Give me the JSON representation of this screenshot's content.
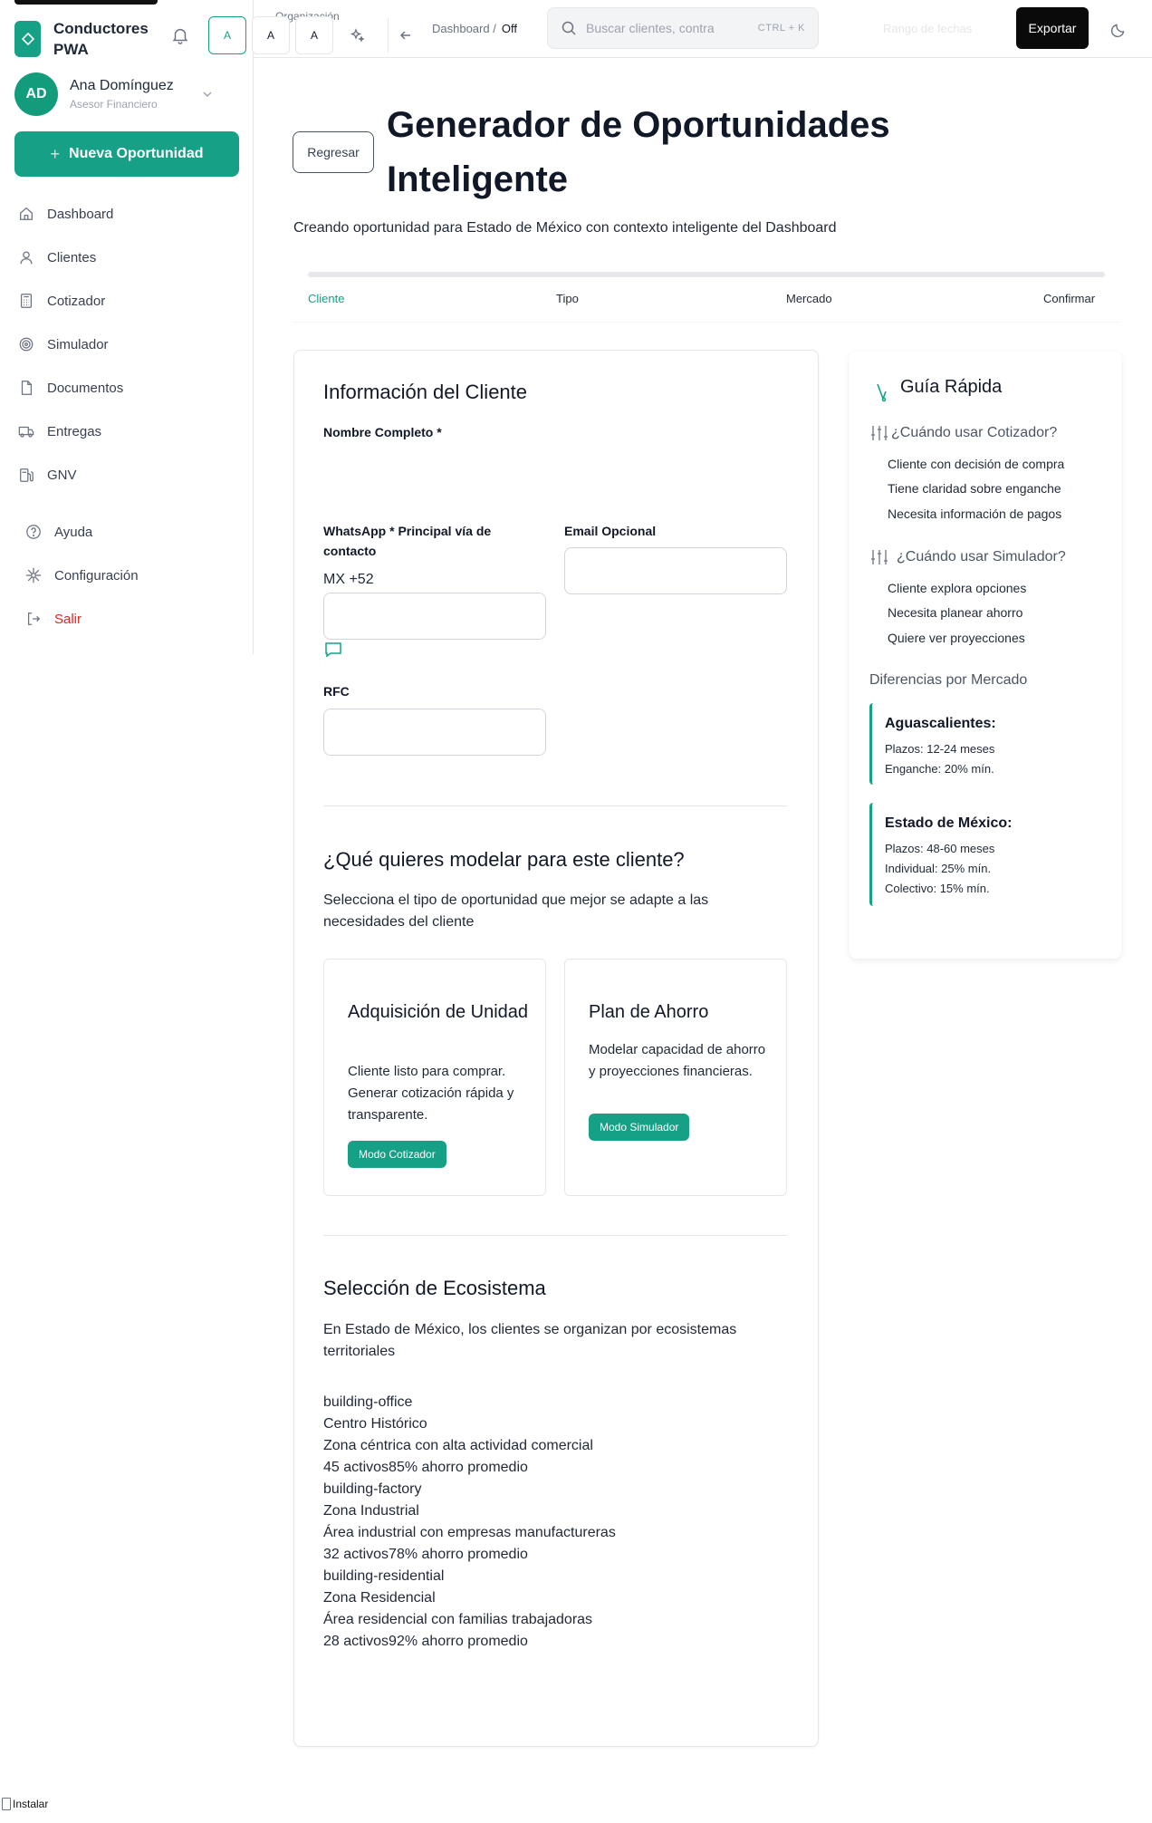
{
  "app": {
    "brand_name": "Conductores PWA",
    "user_initials": "AD",
    "user_name": "Ana Domínguez",
    "user_role": "Asesor Financiero",
    "new_opportunity_label": "Nueva Oportunidad",
    "accent_color": "#16a085"
  },
  "sidebar": {
    "items": [
      {
        "label": "Dashboard",
        "icon": "home-icon"
      },
      {
        "label": "Clientes",
        "icon": "user-icon"
      },
      {
        "label": "Cotizador",
        "icon": "calculator-icon"
      },
      {
        "label": "Simulador",
        "icon": "target-icon"
      },
      {
        "label": "Documentos",
        "icon": "document-icon"
      },
      {
        "label": "Entregas",
        "icon": "truck-icon"
      },
      {
        "label": "GNV",
        "icon": "fuel-icon"
      }
    ],
    "secondary": [
      {
        "label": "Ayuda",
        "icon": "help-icon"
      },
      {
        "label": "Configuración",
        "icon": "settings-icon"
      },
      {
        "label": "Salir",
        "icon": "logout-icon"
      }
    ]
  },
  "header": {
    "org_text": "Organización",
    "font_buttons": [
      "A",
      "A",
      "A"
    ],
    "breadcrumb_parent": "Dashboard /",
    "breadcrumb_current": "Off",
    "search_placeholder": "Buscar clientes, contra",
    "search_shortcut": "CTRL + K",
    "date_range": "Rango de fechas",
    "export_label": "Exportar"
  },
  "page": {
    "back_label": "Regresar",
    "title": "Generador de Oportunidades Inteligente",
    "subtitle": "Creando oportunidad para Estado de México con contexto inteligente del Dashboard"
  },
  "stepper": {
    "steps": [
      "Cliente",
      "Tipo",
      "Mercado",
      "Confirmar"
    ],
    "active_index": 0
  },
  "client_info": {
    "title": "Información del Cliente",
    "name_label": "Nombre Completo *",
    "whatsapp_label": "WhatsApp * Principal vía de contacto",
    "whatsapp_prefix": "MX +52",
    "email_label": "Email Opcional",
    "rfc_label": "RFC"
  },
  "model": {
    "title": "¿Qué quieres modelar para este cliente?",
    "description": "Selecciona el tipo de oportunidad que mejor se adapte a las necesidades del cliente",
    "options": [
      {
        "title": "Adquisición de Unidad",
        "description": "Cliente listo para comprar. Generar cotización rápida y transparente.",
        "button": "Modo Cotizador"
      },
      {
        "title": "Plan de Ahorro",
        "description": "Modelar capacidad de ahorro y proyecciones financieras.",
        "button": "Modo Simulador"
      }
    ]
  },
  "ecosystem": {
    "title": "Selección de Ecosistema",
    "description": "En Estado de México, los clientes se organizan por ecosistemas territoriales",
    "items": [
      {
        "icon": "building-office",
        "name": "Centro Histórico",
        "description": "Zona céntrica con alta actividad comercial",
        "stats": "45 activos85% ahorro promedio"
      },
      {
        "icon": "building-factory",
        "name": "Zona Industrial",
        "description": "Área industrial con empresas manufactureras",
        "stats": "32 activos78% ahorro promedio"
      },
      {
        "icon": "building-residential",
        "name": "Zona Residencial",
        "description": "Área residencial con familias trabajadoras",
        "stats": "28 activos92% ahorro promedio"
      }
    ]
  },
  "guide": {
    "title": "Guía Rápida",
    "cotizador_q": "¿Cuándo usar Cotizador?",
    "cotizador_items": [
      "Cliente con decisión de compra",
      "Tiene claridad sobre enganche",
      "Necesita información de pagos"
    ],
    "simulador_q": "¿Cuándo usar Simulador?",
    "simulador_items": [
      "Cliente explora opciones",
      "Necesita planear ahorro",
      "Quiere ver proyecciones"
    ],
    "diff_title": "Diferencias por Mercado",
    "markets": [
      {
        "name": "Aguascalientes:",
        "lines": [
          "Plazos: 12-24 meses",
          "Enganche: 20% mín."
        ]
      },
      {
        "name": "Estado de México:",
        "lines": [
          "Plazos: 48-60 meses",
          "Individual: 25% mín.",
          "Colectivo: 15% mín."
        ]
      }
    ]
  },
  "footer": {
    "install_label": "Instalar"
  }
}
